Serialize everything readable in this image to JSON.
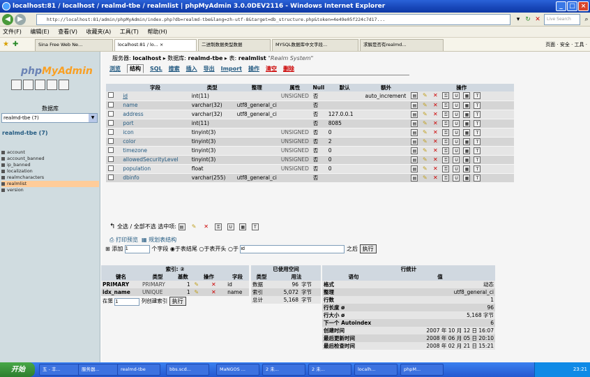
{
  "window": {
    "title": "localhost:81 / localhost / realmd-tbe / realmlist | phpMyAdmin 3.0.0DEV2116 - Windows Internet Explorer"
  },
  "browser": {
    "address": "http://localhost:81/admin/phpMyAdmin/index.php?db=realmd-tbe&lang=zh-utf-8&target=db_structure.php&token=4e49e05f224c7d17...",
    "search_placeholder": "Live Search",
    "menu": [
      "文件(F)",
      "编辑(E)",
      "查看(V)",
      "收藏夹(A)",
      "工具(T)",
      "帮助(H)"
    ],
    "tabs": [
      "Sina Free Web Ne...",
      "localhost:81 / lo... ×",
      "二进制数据类型数据",
      "MYSQL数据库中文字段...",
      "求解是否有realmd..."
    ],
    "tools": "页面 · 安全 · 工具 ·"
  },
  "sidebar": {
    "logo_main": "php",
    "logo_accent": "MyAdmin",
    "db_label": "数据库",
    "db_selected": "realmd-tbe (7)",
    "db_link": "realmd-tbe (7)",
    "tables": [
      "account",
      "account_banned",
      "ip_banned",
      "localization",
      "realmcharacters",
      "realmlist",
      "version"
    ],
    "active_table_index": 5
  },
  "breadcrumb": {
    "server_label": "服务器:",
    "server": "localhost",
    "db_label": "数据库:",
    "db": "realmd-tbe",
    "table_label": "表:",
    "table": "realmlist",
    "comment": "\"Realm System\""
  },
  "tabs": [
    "浏览",
    "结构",
    "SQL",
    "搜索",
    "插入",
    "导出",
    "Import",
    "操作",
    "清空",
    "删除"
  ],
  "structure": {
    "headers": [
      "字段",
      "类型",
      "整理",
      "属性",
      "Null",
      "默认",
      "额外",
      "操作"
    ],
    "rows": [
      {
        "name": "id",
        "type": "int(11)",
        "collation": "",
        "attr": "UNSIGNED",
        "null": "否",
        "default": "",
        "extra": "auto_increment",
        "pk": true
      },
      {
        "name": "name",
        "type": "varchar(32)",
        "collation": "utf8_general_ci",
        "attr": "",
        "null": "否",
        "default": "",
        "extra": "",
        "pk": false
      },
      {
        "name": "address",
        "type": "varchar(32)",
        "collation": "utf8_general_ci",
        "attr": "",
        "null": "否",
        "default": "127.0.0.1",
        "extra": "",
        "pk": false
      },
      {
        "name": "port",
        "type": "int(11)",
        "collation": "",
        "attr": "",
        "null": "否",
        "default": "8085",
        "extra": "",
        "pk": false
      },
      {
        "name": "icon",
        "type": "tinyint(3)",
        "collation": "",
        "attr": "UNSIGNED",
        "null": "否",
        "default": "0",
        "extra": "",
        "pk": false
      },
      {
        "name": "color",
        "type": "tinyint(3)",
        "collation": "",
        "attr": "UNSIGNED",
        "null": "否",
        "default": "2",
        "extra": "",
        "pk": false
      },
      {
        "name": "timezone",
        "type": "tinyint(3)",
        "collation": "",
        "attr": "UNSIGNED",
        "null": "否",
        "default": "0",
        "extra": "",
        "pk": false
      },
      {
        "name": "allowedSecurityLevel",
        "type": "tinyint(3)",
        "collation": "",
        "attr": "UNSIGNED",
        "null": "否",
        "default": "0",
        "extra": "",
        "pk": false
      },
      {
        "name": "population",
        "type": "float",
        "collation": "",
        "attr": "UNSIGNED",
        "null": "否",
        "default": "0",
        "extra": "",
        "pk": false
      },
      {
        "name": "dbinfo",
        "type": "varchar(255)",
        "collation": "utf8_general_ci",
        "attr": "",
        "null": "否",
        "default": "",
        "extra": "",
        "pk": false
      }
    ]
  },
  "check_row": {
    "label": "全选 / 全部不选 选中项:"
  },
  "print_row": {
    "print": "打印预览",
    "propose": "规划表结构"
  },
  "add_row": {
    "label": "添加",
    "count": "1",
    "suffix": "个字段",
    "opt1": "于表结尾",
    "opt2": "于表开头",
    "opt3": "于",
    "after_field": "id",
    "after_label": "之后",
    "exec": "执行"
  },
  "indexes": {
    "title": "索引: ②",
    "headers": [
      "键名",
      "类型",
      "基数",
      "操作",
      "字段"
    ],
    "rows": [
      {
        "key": "PRIMARY",
        "type": "PRIMARY",
        "card": "1",
        "field": "id"
      },
      {
        "key": "idx_name",
        "type": "UNIQUE",
        "card": "1",
        "field": "name"
      }
    ],
    "create_label": "在第",
    "create_count": "1",
    "create_suffix": "列创建索引",
    "exec": "执行"
  },
  "space": {
    "title": "已使用空间",
    "headers": [
      "类型",
      "用法"
    ],
    "rows": [
      {
        "type": "数据",
        "val": "96",
        "unit": "字节"
      },
      {
        "type": "索引",
        "val": "5,072",
        "unit": "字节"
      },
      {
        "type": "总计",
        "val": "5,168",
        "unit": "字节"
      }
    ]
  },
  "rowstats": {
    "title": "行统计",
    "headers": [
      "语句",
      "值"
    ],
    "rows": [
      {
        "k": "格式",
        "v": "动态"
      },
      {
        "k": "整理",
        "v": "utf8_general_ci"
      },
      {
        "k": "行数",
        "v": "1"
      },
      {
        "k": "行长度 ø",
        "v": "96"
      },
      {
        "k": "行大小 ø",
        "v": "5,168 字节"
      },
      {
        "k": "下一个 Autoindex",
        "v": "6"
      },
      {
        "k": "创建时间",
        "v": "2007 年 10 月 12 日 16:07"
      },
      {
        "k": "最后更新时间",
        "v": "2008 年 06 月 05 日 20:10"
      },
      {
        "k": "最后检查时间",
        "v": "2008 年 02 月 21 日 15:21"
      }
    ]
  },
  "taskbar": {
    "start": "开始",
    "items": [
      "五 - 丰...",
      "服务器...",
      "realmd-tbe",
      "bbs.scd...",
      "MaNGOS ...",
      "2 未...",
      "2 未...",
      "localh...",
      "phpM..."
    ],
    "clock": "23:21"
  }
}
